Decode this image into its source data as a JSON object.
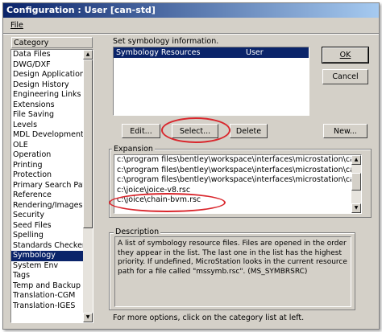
{
  "window": {
    "title": "Configuration : User [can-std]"
  },
  "menu": {
    "file": "File"
  },
  "category": {
    "header": "Category",
    "items": [
      "Data Files",
      "DWG/DXF",
      "Design Applications",
      "Design History",
      "Engineering Links",
      "Extensions",
      "File Saving",
      "Levels",
      "MDL Development",
      "OLE",
      "Operation",
      "Printing",
      "Protection",
      "Primary Search Paths",
      "Reference",
      "Rendering/Images",
      "Security",
      "Seed Files",
      "Spelling",
      "Standards Checker",
      "Symbology",
      "System Env",
      "Tags",
      "Temp and Backup Files",
      "Translation-CGM",
      "Translation-IGES"
    ],
    "selected": "Symbology"
  },
  "main": {
    "heading": "Set symbology information.",
    "resources": [
      {
        "name": "Symbology Resources",
        "level": "User"
      }
    ]
  },
  "buttons": {
    "ok": "OK",
    "cancel": "Cancel",
    "edit": "Edit...",
    "select": "Select...",
    "delete": "Delete",
    "new": "New..."
  },
  "expansion": {
    "title": "Expansion",
    "lines": [
      "c:\\program files\\bentley\\workspace\\interfaces\\microstation\\can-std\\symb\\",
      "c:\\program files\\bentley\\workspace\\interfaces\\microstation\\can-std\\symb\\",
      "c:\\program files\\bentley\\workspace\\interfaces\\microstation\\can-std\\symb\\",
      "c:\\joice\\joice-v8.rsc",
      "c:\\joice\\chain-bvm.rsc"
    ]
  },
  "description": {
    "title": "Description",
    "text": "A list of symbology resource files.  Files are opened in the order they appear in the list.  The last one in the list has the highest priority. If undefined, MicroStation looks in the current resource path for a file called \"mssymb.rsc\".  (MS_SYMBRSRC)"
  },
  "footer": {
    "hint": "For more options, click on the category list at left."
  },
  "colors": {
    "title_start": "#0a246a",
    "title_end": "#a6caf0",
    "selection": "#0a246a",
    "annotation": "#d9262c",
    "face": "#d4d0c8"
  }
}
